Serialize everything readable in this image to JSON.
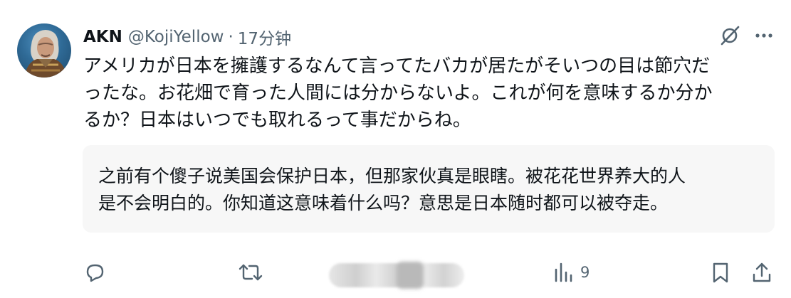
{
  "author": {
    "display_name": "AKN",
    "handle": "@KojiYellow",
    "separator": "·",
    "time": "17分钟"
  },
  "post": {
    "text": "アメリカが日本を擁護するなんて言ってたバカが居たがそいつの目は節穴だ\nったな。お花畑で育った人間には分からないよ。これが何を意味するか分か\nるか？日本はいつでも取れるって事だからね。"
  },
  "translation": {
    "text": "之前有个傻子说美国会保护日本，但那家伙真是眼瞎。被花花世界养大的人\n是不会明白的。你知道这意味着什么吗？意思是日本随时都可以被夺走。"
  },
  "icons": {
    "grok": "grok-icon",
    "more": "more-dots-icon",
    "reply": "reply-icon",
    "repost": "repost-icon",
    "views": "views-icon",
    "bookmark": "bookmark-icon",
    "share": "share-icon"
  },
  "stats": {
    "views": "9"
  },
  "colors": {
    "text": "#0f1419",
    "secondary": "#536471",
    "translation_bg": "#f7f7f7"
  }
}
